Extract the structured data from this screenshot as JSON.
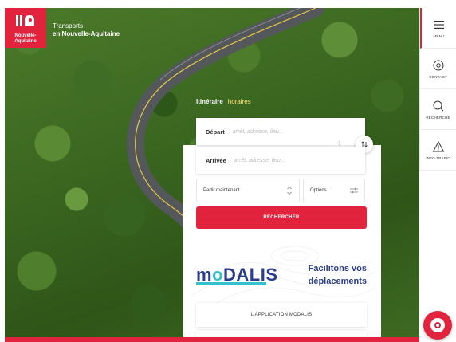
{
  "brand": {
    "logo_line1": "Nouvelle-",
    "logo_line2": "Aquitaine",
    "title_line1": "Transports",
    "title_line2": "en Nouvelle-Aquitaine"
  },
  "right_nav": [
    {
      "label": "MENU",
      "icon": "menu-icon"
    },
    {
      "label": "CONTACT",
      "icon": "at-icon"
    },
    {
      "label": "RECHERCHE",
      "icon": "search-icon"
    },
    {
      "label": "INFO TRAFIC",
      "icon": "warning-icon"
    }
  ],
  "tabs": {
    "itinerary": "itinéraire",
    "schedules": "horaires"
  },
  "form": {
    "departure_label": "Départ",
    "departure_placeholder": "arrêt, adresse, lieu...",
    "arrival_label": "Arrivée",
    "arrival_placeholder": "arrêt, adresse, lieu...",
    "time_select": "Partir maintenant",
    "options_select": "Options",
    "search_button": "RECHERCHER"
  },
  "modalis": {
    "logo_pre": "m",
    "logo_o": "o",
    "logo_post": "DALIS",
    "tagline_line1": "Facilitons vos",
    "tagline_line2": "déplacements",
    "app_button": "L'APPLICATION MODALIS"
  },
  "colors": {
    "accent": "#e2233d",
    "modalis_blue": "#2a3d8f",
    "modalis_cyan": "#33c2cc"
  }
}
